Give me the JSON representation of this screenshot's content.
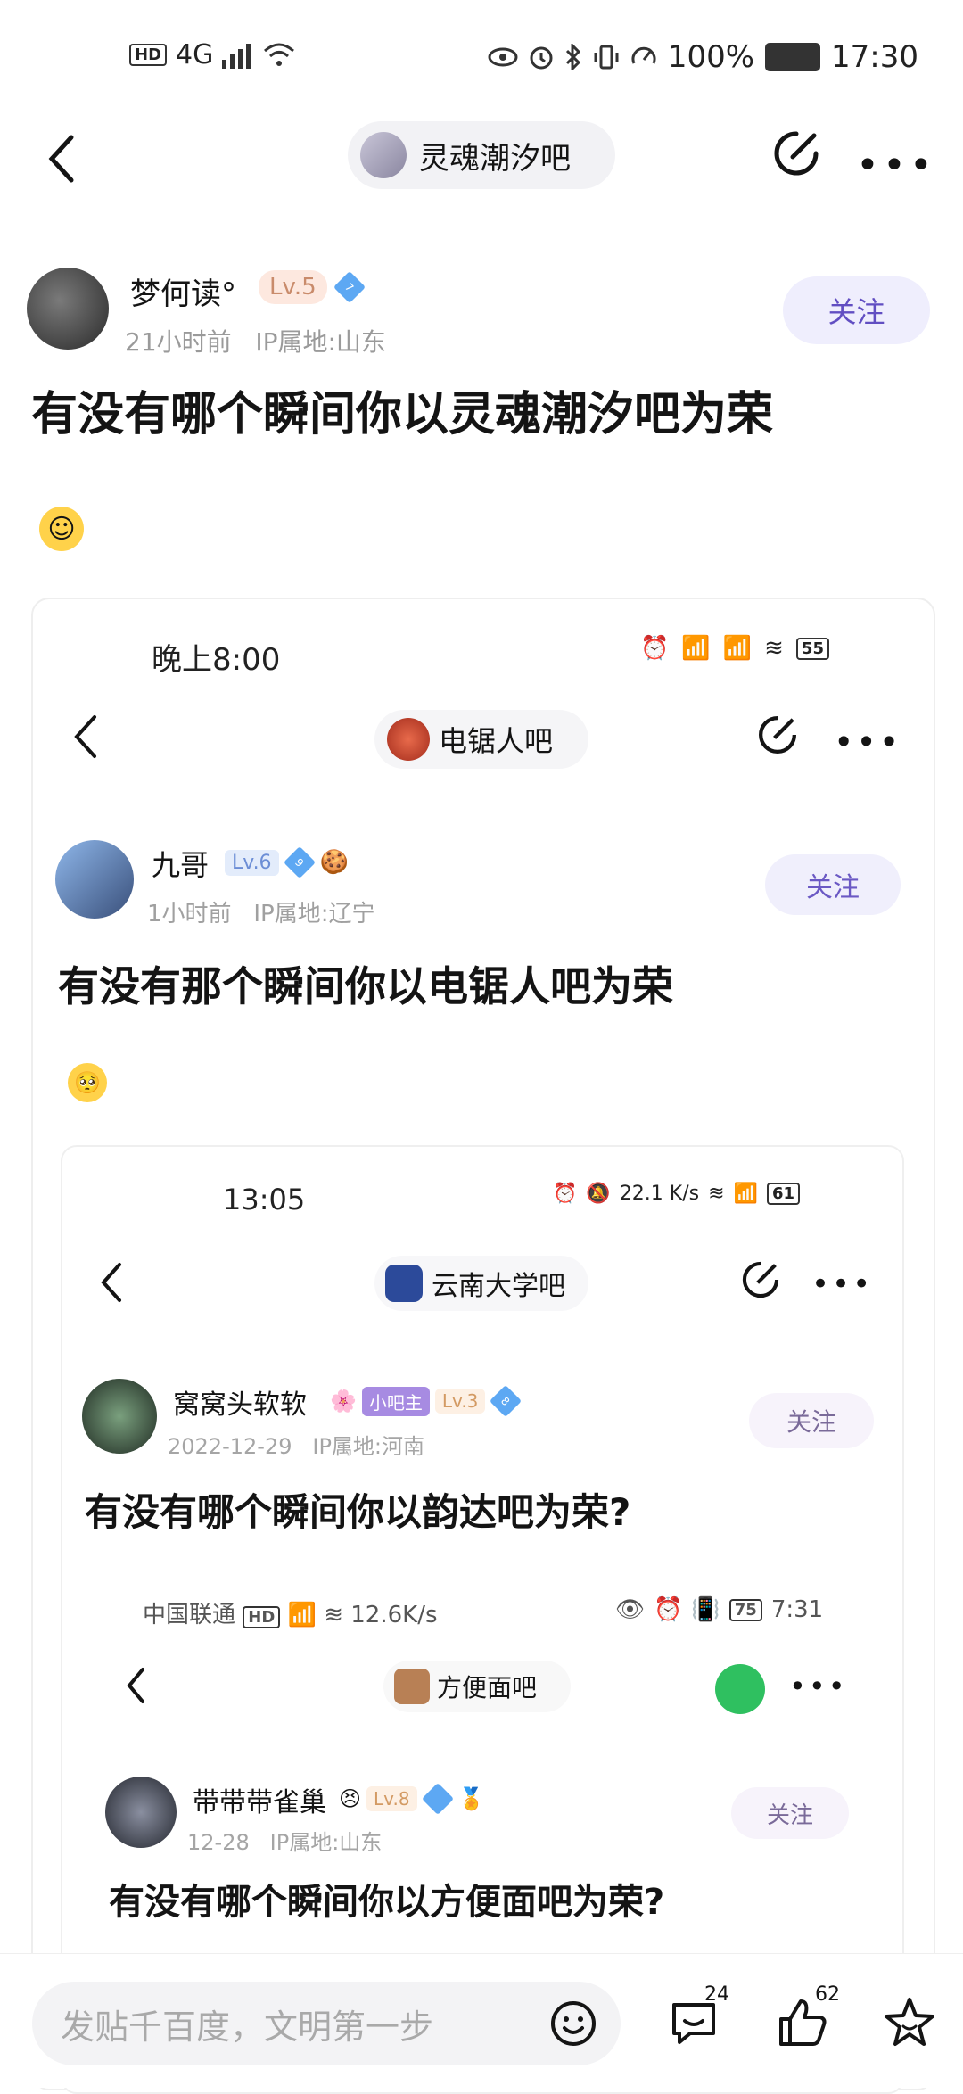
{
  "status_bar": {
    "network": "4G",
    "battery": "100%",
    "time": "17:30"
  },
  "nav": {
    "forum_name": "灵魂潮汐吧"
  },
  "post": {
    "author": "梦何读°",
    "level": "Lv.5",
    "rank_badge": "7",
    "time_ago": "21小时前",
    "ip_location": "IP属地:山东",
    "follow_label": "关注",
    "title": "有没有哪个瞬间你以灵魂潮汐吧为荣",
    "emoji": "☺"
  },
  "embed1": {
    "time": "晚上8:00",
    "battery": "55",
    "forum_name": "电锯人吧",
    "author": "九哥",
    "level": "Lv.6",
    "rank_badge": "9",
    "time_ago": "1小时前",
    "ip_location": "IP属地:辽宁",
    "follow_label": "关注",
    "title": "有没有那个瞬间你以电锯人吧为荣",
    "emoji": "🥺"
  },
  "embed2": {
    "time": "13:05",
    "net_speed": "22.1 K/s",
    "battery": "61",
    "forum_name": "云南大学吧",
    "author": "窝窝头软软",
    "mod_tag": "小吧主",
    "level": "Lv.3",
    "rank_badge": "8",
    "date": "2022-12-29",
    "ip_location": "IP属地:河南",
    "follow_label": "关注",
    "title": "有没有哪个瞬间你以韵达吧为荣?"
  },
  "embed3": {
    "carrier": "中国联通",
    "net_speed": "12.6K/s",
    "battery": "75",
    "time": "7:31",
    "forum_name": "方便面吧",
    "author": "带带带雀巢",
    "level": "Lv.8",
    "date": "12-28",
    "ip_location": "IP属地:山东",
    "follow_label": "关注",
    "title": "有没有哪个瞬间你以方便面吧为荣?"
  },
  "bottom": {
    "input_placeholder": "发贴千百度，文明第一步",
    "comment_count": "24",
    "like_count": "62"
  },
  "colors": {
    "accent": "#614ec2",
    "follow_bg": "#efeefd"
  }
}
